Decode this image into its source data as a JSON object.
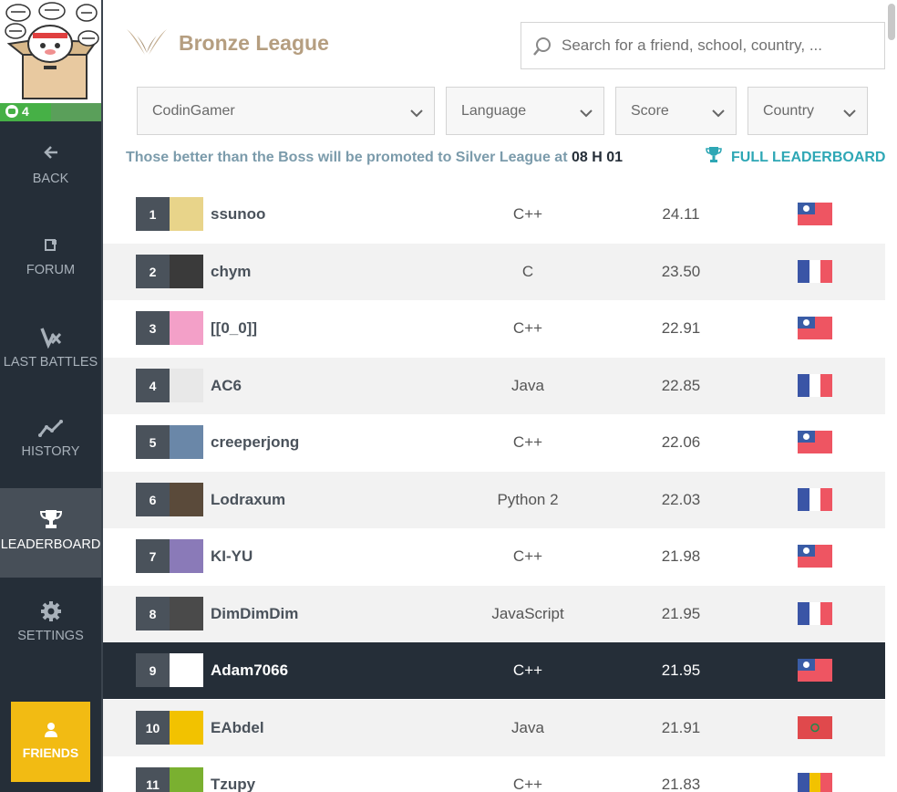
{
  "sidebar": {
    "level": "4",
    "level_progress": 0.5,
    "items": [
      {
        "label": "BACK",
        "icon": "arrow-left-icon"
      },
      {
        "label": "FORUM",
        "icon": "forum-icon"
      },
      {
        "label": "LAST BATTLES",
        "icon": "battles-icon"
      },
      {
        "label": "HISTORY",
        "icon": "history-chart-icon"
      },
      {
        "label": "LEADERBOARD",
        "icon": "trophy-icon",
        "active": true
      },
      {
        "label": "SETTINGS",
        "icon": "gear-icon"
      }
    ],
    "friends_label": "FRIENDS"
  },
  "header": {
    "league_title": "Bronze League",
    "search_placeholder": "Search for a friend, school, country, ..."
  },
  "filters": {
    "player": "CodinGamer",
    "language": "Language",
    "score": "Score",
    "country": "Country"
  },
  "promotion": {
    "text": "Those better than the Boss will be promoted to Silver League at",
    "time": "08 H 01"
  },
  "full_leaderboard_label": "FULL LEADERBOARD",
  "colors": {
    "sidebar_bg": "#252e38",
    "league_gold": "#b59e80",
    "accent_teal": "#2ea7b5",
    "friends_yellow": "#f2bb13",
    "highlight_row": "#252e38"
  },
  "leaderboard": [
    {
      "rank": "1",
      "pseudo": "ssunoo",
      "language": "C++",
      "score": "24.11",
      "country": "Taiwan"
    },
    {
      "rank": "2",
      "pseudo": "chym",
      "language": "C",
      "score": "23.50",
      "country": "France"
    },
    {
      "rank": "3",
      "pseudo": "[[0_0]]",
      "language": "C++",
      "score": "22.91",
      "country": "Taiwan"
    },
    {
      "rank": "4",
      "pseudo": "AC6",
      "language": "Java",
      "score": "22.85",
      "country": "France"
    },
    {
      "rank": "5",
      "pseudo": "creeperjong",
      "language": "C++",
      "score": "22.06",
      "country": "Taiwan"
    },
    {
      "rank": "6",
      "pseudo": "Lodraxum",
      "language": "Python 2",
      "score": "22.03",
      "country": "France"
    },
    {
      "rank": "7",
      "pseudo": "KI-YU",
      "language": "C++",
      "score": "21.98",
      "country": "Taiwan"
    },
    {
      "rank": "8",
      "pseudo": "DimDimDim",
      "language": "JavaScript",
      "score": "21.95",
      "country": "France"
    },
    {
      "rank": "9",
      "pseudo": "Adam7066",
      "language": "C++",
      "score": "21.95",
      "country": "Taiwan",
      "me": true
    },
    {
      "rank": "10",
      "pseudo": "EAbdel",
      "language": "Java",
      "score": "21.91",
      "country": "Morocco"
    },
    {
      "rank": "11",
      "pseudo": "Tzupy",
      "language": "C++",
      "score": "21.83",
      "country": "Romania"
    }
  ]
}
